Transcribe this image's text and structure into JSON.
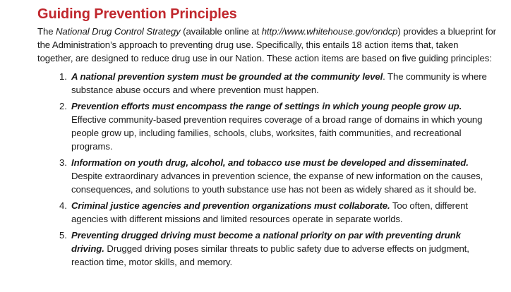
{
  "document": {
    "title": "Guiding Prevention Principles",
    "intro": {
      "part1": "The ",
      "strategy_name": "National Drug Control Strategy",
      "part2": " (available online at ",
      "url": "http://www.whitehouse.gov/ondcp",
      "part3": ") provides a blueprint for the Administration’s approach to preventing drug use. Specifically, this entails 18 action items that, taken together, are designed to reduce drug use in our Nation. These action items are based on five guiding principles:"
    },
    "principles": [
      {
        "number": "1.",
        "lead": "A national prevention system must be grounded at the community level",
        "body": ". The community is where substance abuse occurs and where prevention must happen."
      },
      {
        "number": "2.",
        "lead": "Prevention efforts must encompass the range of settings in which young people grow up.",
        "body": " Effective community-based prevention requires coverage of a broad range of domains in which young people grow up, including families, schools, clubs, worksites, faith communities, and recreational programs."
      },
      {
        "number": "3.",
        "lead": "Information on youth drug, alcohol, and tobacco use must be developed and disseminated.",
        "body": " Despite extraordinary advances in prevention science, the expanse of new information on the causes, consequences, and solutions to youth substance use has not been as widely shared as it should be."
      },
      {
        "number": "4.",
        "lead": "Criminal justice agencies and prevention organizations must collaborate.",
        "body": " Too often, different agencies with different missions and limited resources operate in separate worlds."
      },
      {
        "number": "5.",
        "lead": "Preventing drugged driving must become a national priority on par with preventing drunk driving.",
        "body": " Drugged driving poses similar threats to public safety due to adverse effects on judgment, reaction time, motor skills, and memory."
      }
    ],
    "colors": {
      "title": "#c0272d",
      "text": "#1a1a1a"
    }
  }
}
